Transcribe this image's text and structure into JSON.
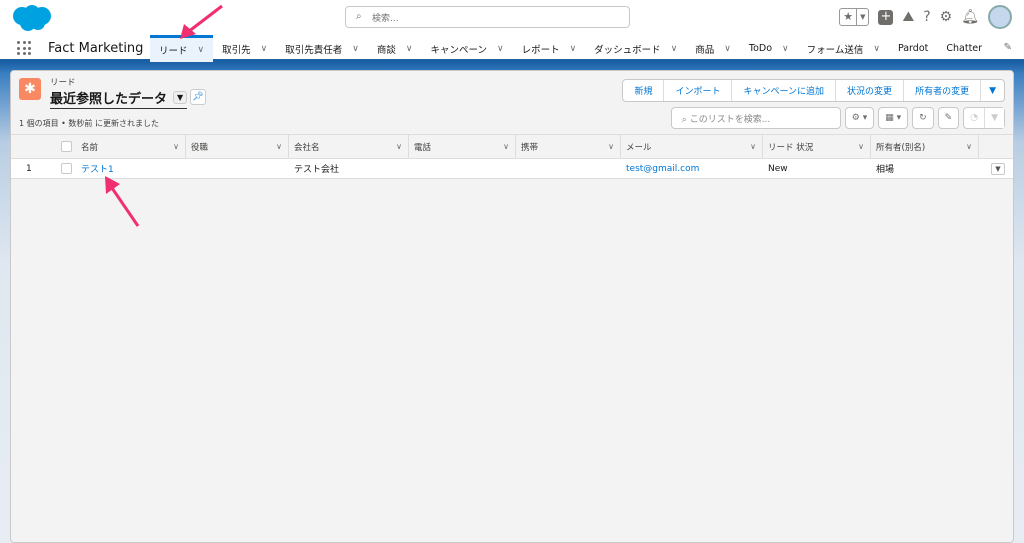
{
  "header": {
    "search_placeholder": "検索...",
    "app_name": "Fact Marketing"
  },
  "nav": {
    "tabs": [
      {
        "label": "リード",
        "active": true,
        "chevron": true
      },
      {
        "label": "取引先",
        "chevron": true
      },
      {
        "label": "取引先責任者",
        "chevron": true
      },
      {
        "label": "商談",
        "chevron": true
      },
      {
        "label": "キャンペーン",
        "chevron": true
      },
      {
        "label": "レポート",
        "chevron": true
      },
      {
        "label": "ダッシュボード",
        "chevron": true
      },
      {
        "label": "商品",
        "chevron": true
      },
      {
        "label": "ToDo",
        "chevron": true
      },
      {
        "label": "フォーム送信",
        "chevron": true
      },
      {
        "label": "Pardot",
        "chevron": false
      },
      {
        "label": "Chatter",
        "chevron": false
      }
    ]
  },
  "list": {
    "object_label": "リード",
    "view_name": "最近参照したデータ",
    "meta": "1 個の項目 • 数秒前 に更新されました",
    "buttons": [
      "新規",
      "インポート",
      "キャンペーンに追加",
      "状況の変更",
      "所有者の変更"
    ],
    "search_placeholder": "このリストを検索...",
    "columns": [
      "名前",
      "役職",
      "会社名",
      "電話",
      "携帯",
      "メール",
      "リード 状況",
      "所有者(別名)"
    ],
    "rows": [
      {
        "num": "1",
        "name": "テスト1",
        "title": "",
        "company": "テスト会社",
        "phone": "",
        "mobile": "",
        "email": "test@gmail.com",
        "status": "New",
        "owner": "相場"
      }
    ]
  },
  "colors": {
    "accent": "#0176d3",
    "brand_band": "#1b5fa5",
    "lead_icon": "#f88962",
    "annotation": "#f0306e"
  }
}
